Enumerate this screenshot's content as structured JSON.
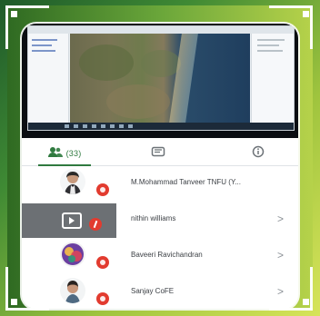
{
  "tabs": [
    {
      "label": "(33)",
      "icon": "participants-icon",
      "active": true
    },
    {
      "label": "",
      "icon": "chat-icon",
      "active": false
    },
    {
      "label": "",
      "icon": "info-icon",
      "active": false
    }
  ],
  "participants": [
    {
      "name": "M.Mohammad Tanveer TNFU (Y...",
      "avatar": "avatar-man-suit",
      "badge": "red-dot"
    },
    {
      "name": "nithin williams",
      "avatar": "screen-share-tile",
      "badge": "mic-muted"
    },
    {
      "name": "Baveeri Ravichandran",
      "avatar": "avatar-illustration",
      "badge": "red-dot"
    },
    {
      "name": "Sanjay CoFE",
      "avatar": "avatar-person",
      "badge": "red-dot"
    }
  ],
  "chevron_glyph": ">",
  "colors": {
    "accent": "#2f7a3f",
    "badge": "#e23b2f",
    "text": "#3b3f44"
  }
}
